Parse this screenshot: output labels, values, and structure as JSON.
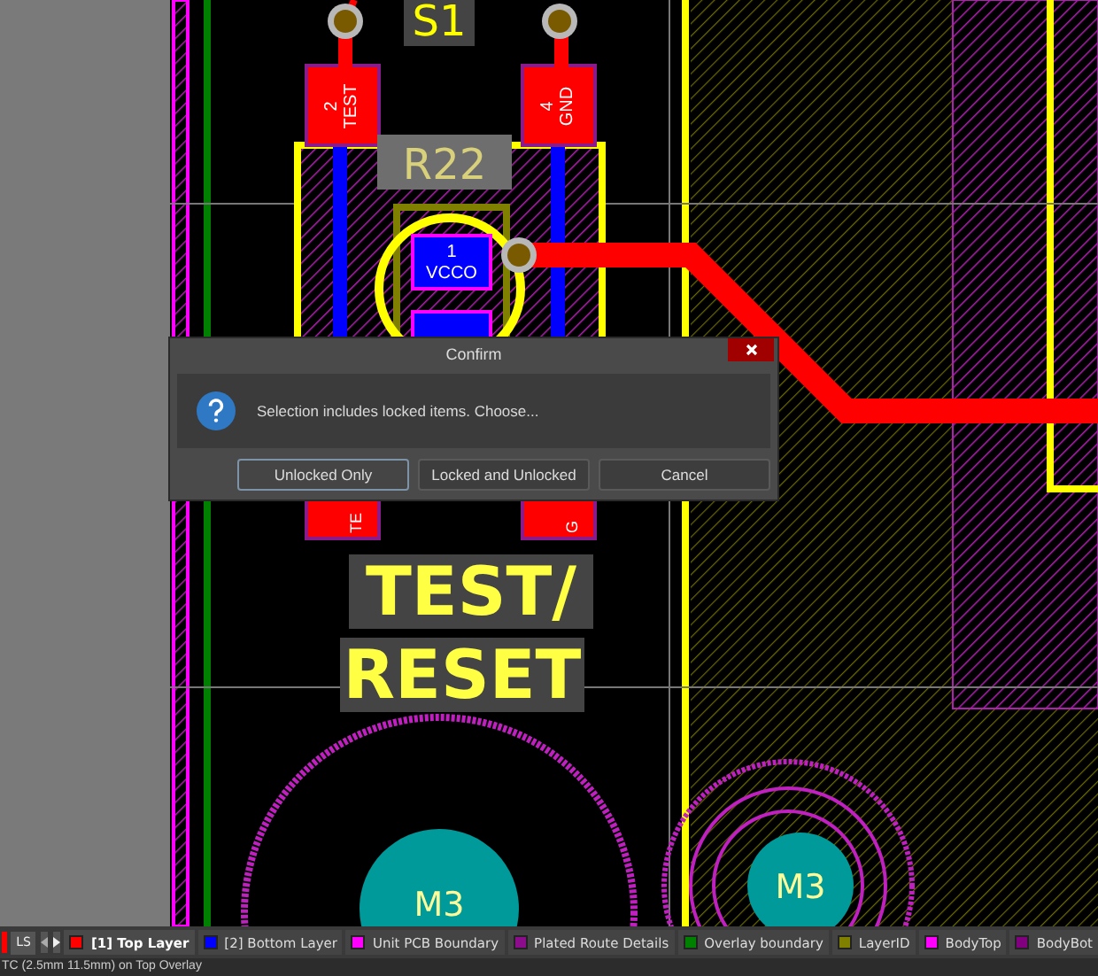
{
  "pcb": {
    "silk_labels": [
      {
        "kind": "plain",
        "text": "S1"
      },
      {
        "kind": "mirrored",
        "text": "R22"
      },
      {
        "kind": "boxed",
        "text": "TEST/"
      },
      {
        "kind": "boxed",
        "text": "RESET"
      }
    ],
    "pad_labels": [
      {
        "number": "2",
        "name": "TEST"
      },
      {
        "number": "4",
        "name": "GND"
      }
    ],
    "center_pad": {
      "number": "1",
      "name": "VCCO"
    },
    "cut_pad_labels": [
      "TE",
      "G"
    ],
    "holes": [
      "M3",
      "M3"
    ]
  },
  "dialog": {
    "title": "Confirm",
    "message": "Selection includes locked items. Choose...",
    "buttons": [
      {
        "label": "Unlocked Only",
        "selected": true
      },
      {
        "label": "Locked and Unlocked",
        "selected": false
      },
      {
        "label": "Cancel",
        "selected": false
      }
    ]
  },
  "layer_bar": {
    "ls_label": "LS",
    "tabs": [
      {
        "label": "[1] Top Layer",
        "color": "#ff0000",
        "selected": true
      },
      {
        "label": "[2] Bottom Layer",
        "color": "#0000ff",
        "selected": false
      },
      {
        "label": "Unit PCB Boundary",
        "color": "#ff00ff",
        "selected": false
      },
      {
        "label": "Plated Route Details",
        "color": "#8b0d8b",
        "selected": false
      },
      {
        "label": "Overlay boundary",
        "color": "#008000",
        "selected": false
      },
      {
        "label": "LayerID",
        "color": "#808000",
        "selected": false
      },
      {
        "label": "BodyTop",
        "color": "#ff00ff",
        "selected": false
      },
      {
        "label": "BodyBot",
        "color": "#800080",
        "selected": false
      }
    ]
  },
  "status_bar": {
    "text": "TC (2.5mm 11.5mm) on Top Overlay"
  }
}
